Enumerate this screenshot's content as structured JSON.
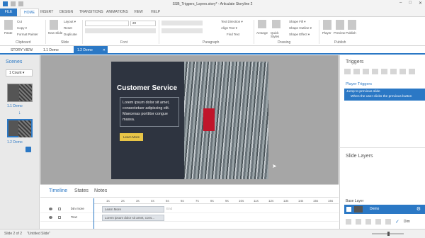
{
  "window": {
    "title": "SSB_Triggers_Layers.story* - Articulate Storyline 2",
    "min": "–",
    "max": "□",
    "close": "✕"
  },
  "ribbon_tabs": [
    "FILE",
    "HOME",
    "INSERT",
    "DESIGN",
    "TRANSITIONS",
    "ANIMATIONS",
    "VIEW",
    "HELP"
  ],
  "ribbon": {
    "paste": "Paste",
    "cut": "Cut",
    "copy": "Copy ▾",
    "format_painter": "Format Painter",
    "new_slide": "New Slide",
    "layout": "Layout ▾",
    "reset": "Reset",
    "duplicate": "Duplicate",
    "font_size": "20",
    "text_direction": "Text Direction ▾",
    "align_text": "Align Text ▾",
    "find_text": "Find Text",
    "arrange": "Arrange",
    "quick_styles": "Quick Styles",
    "shape_fill": "Shape Fill ▾",
    "shape_outline": "Shape Outline ▾",
    "shape_effect": "Shape Effect ▾",
    "player": "Player",
    "preview": "Preview",
    "publish": "Publish",
    "groups": {
      "clipboard": "Clipboard",
      "slide": "Slide",
      "font": "Font",
      "paragraph": "Paragraph",
      "drawing": "Drawing",
      "publish": "Publish"
    }
  },
  "doc_tabs": [
    "STORY VIEW",
    "1.1 Demo",
    "1.2 Demo"
  ],
  "doc_tab_close": "✕",
  "scenes": {
    "title": "Scenes",
    "selector": "1 Count ▾",
    "slides": [
      {
        "label": "1.1 Demo"
      },
      {
        "label": "1.2 Demo"
      }
    ]
  },
  "slide": {
    "heading": "Customer Service",
    "body": "Lorem ipsum dolor sit amet, consectetuer adipiscing elit. Maecenas porttitor congue massa.",
    "button": "Learn More"
  },
  "timeline": {
    "tabs": [
      "Timeline",
      "States",
      "Notes"
    ],
    "ticks": [
      "1s",
      "2s",
      "3s",
      "4s",
      "5s",
      "6s",
      "7s",
      "8s",
      "9s",
      "10s",
      "11s",
      "12s",
      "13s",
      "14s",
      "15s",
      "16s"
    ],
    "end_label": "End",
    "rows": [
      {
        "name": "btn more",
        "bar": "Learn More"
      },
      {
        "name": "Text",
        "bar": "Lorem ipsum dolor sit amet, cons..."
      }
    ]
  },
  "triggers": {
    "title": "Triggers",
    "section": "Player Triggers",
    "items": [
      {
        "action": "Jump to previous slide",
        "condition": "When the user clicks the previous button"
      }
    ]
  },
  "layers": {
    "title": "Slide Layers",
    "base_label": "Base Layer",
    "base_name": "Demo",
    "dim": "Dim"
  },
  "status": {
    "slide": "Slide 2 of 2",
    "scene": "\"Untitled Slide\""
  },
  "colors": {
    "accent": "#2b78c5",
    "slide_bg": "#2e3440",
    "button": "#e8c547"
  }
}
